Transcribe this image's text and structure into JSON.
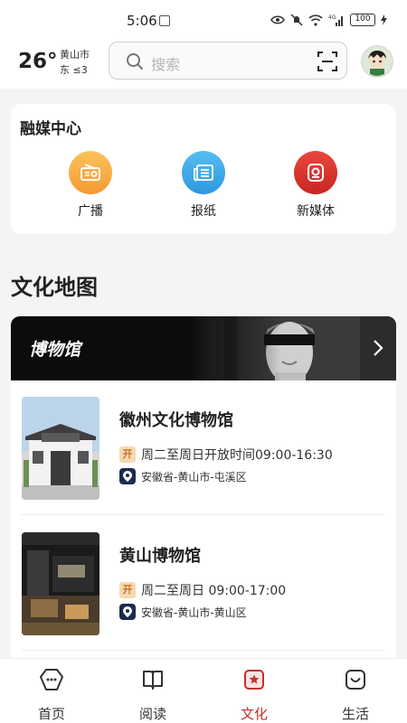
{
  "status_bar": {
    "time": "5:06",
    "network": "4G",
    "battery": "100"
  },
  "header": {
    "temperature": "26°",
    "city": "黄山市",
    "wind": "东 ≤3",
    "search_placeholder": "搜索"
  },
  "media_center": {
    "title": "融媒中心",
    "items": [
      {
        "label": "广播",
        "icon": "radio-icon",
        "color": "#f5a942"
      },
      {
        "label": "报纸",
        "icon": "newspaper-icon",
        "color": "#3aa9e6"
      },
      {
        "label": "新媒体",
        "icon": "new-media-icon",
        "color": "#d9312b"
      }
    ]
  },
  "culture_map": {
    "title": "文化地图",
    "category": "博物馆",
    "open_badge": "开",
    "museums": [
      {
        "name": "徽州文化博物馆",
        "hours": "周二至周日开放时间09:00-16:30",
        "address": "安徽省-黄山市-屯溪区"
      },
      {
        "name": "黄山博物馆",
        "hours": "周二至周日 09:00-17:00",
        "address": "安徽省-黄山市-黄山区"
      }
    ]
  },
  "bottom_nav": {
    "items": [
      {
        "label": "首页",
        "icon": "home-icon"
      },
      {
        "label": "阅读",
        "icon": "book-icon"
      },
      {
        "label": "文化",
        "icon": "culture-icon"
      },
      {
        "label": "生活",
        "icon": "life-icon"
      }
    ],
    "active": "文化"
  },
  "colors": {
    "accent": "#c0312f",
    "background": "#f3f4f6"
  }
}
